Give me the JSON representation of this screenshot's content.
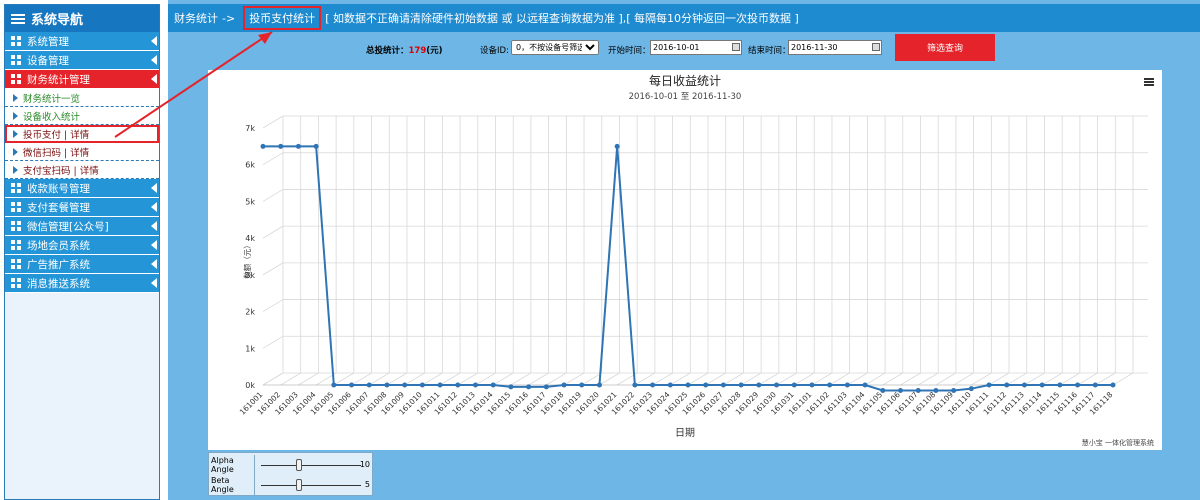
{
  "sidebar": {
    "title": "系统导航",
    "groups_top": [
      {
        "label": "系统管理"
      },
      {
        "label": "设备管理"
      },
      {
        "label": "财务统计管理"
      }
    ],
    "sub_items": [
      {
        "label": "财务统计一览"
      },
      {
        "label": "设备收入统计"
      },
      {
        "label": "投币支付 | 详情"
      },
      {
        "label": "微信扫码 | 详情"
      },
      {
        "label": "支付宝扫码 | 详情"
      }
    ],
    "groups_bottom": [
      {
        "label": "收款账号管理"
      },
      {
        "label": "支付套餐管理"
      },
      {
        "label": "微信管理[公众号]"
      },
      {
        "label": "场地会员系统"
      },
      {
        "label": "广告推广系统"
      },
      {
        "label": "消息推送系统"
      }
    ]
  },
  "topbar": {
    "crumb_root": "财务统计",
    "separator": "->",
    "crumb_current": "投币支付统计",
    "notice": "[ 如数据不正确请清除硬件初始数据 或 以远程查询数据为准 ],[ 每隔每10分钟返回一次投币数据 ]"
  },
  "filter": {
    "total_label": "总投统计：",
    "total_amount": "179",
    "total_unit": "(元)",
    "device_label": "设备ID:",
    "device_value": "0，不按设备号筛选",
    "start_label": "开始时间：",
    "start_value": "2016-10-01",
    "end_label": "结束时间：",
    "end_value": "2016-11-30",
    "submit_label": "筛选查询"
  },
  "sliders": [
    {
      "label": "Alpha Angle",
      "value": "10",
      "fraction": 0.38
    },
    {
      "label": "Beta Angle",
      "value": "5",
      "fraction": 0.38
    }
  ],
  "credit": "慧小宝 一体化管理系统",
  "chart_data": {
    "type": "line",
    "title": "每日收益统计",
    "subtitle": "2016-10-01 至 2016-11-30",
    "ylabel": "数额（元）",
    "xlabel": "日期",
    "ylim": [
      0,
      7000
    ],
    "yticks": [
      "0k",
      "1k",
      "2k",
      "3k",
      "4k",
      "5k",
      "6k",
      "7k"
    ],
    "grid": true,
    "categories": [
      "161001",
      "161002",
      "161003",
      "161004",
      "161005",
      "161006",
      "161007",
      "161008",
      "161009",
      "161010",
      "161011",
      "161012",
      "161013",
      "161014",
      "161015",
      "161016",
      "161017",
      "161018",
      "161019",
      "161020",
      "161021",
      "161022",
      "161023",
      "161024",
      "161025",
      "161026",
      "161027",
      "161028",
      "161029",
      "161030",
      "161031",
      "161101",
      "161102",
      "161103",
      "161104",
      "161105",
      "161106",
      "161107",
      "161108",
      "161109",
      "161110",
      "161111",
      "161112",
      "161113",
      "161114",
      "161115",
      "161116",
      "161117",
      "161118"
    ],
    "values": [
      6500,
      6500,
      6500,
      6500,
      0,
      0,
      0,
      0,
      0,
      0,
      0,
      0,
      0,
      0,
      -50,
      -50,
      -50,
      0,
      0,
      0,
      6500,
      0,
      0,
      0,
      0,
      0,
      0,
      0,
      0,
      0,
      0,
      0,
      0,
      0,
      0,
      -150,
      -150,
      -150,
      -150,
      -150,
      -100,
      0,
      0,
      0,
      0,
      0,
      0,
      0,
      0
    ]
  }
}
